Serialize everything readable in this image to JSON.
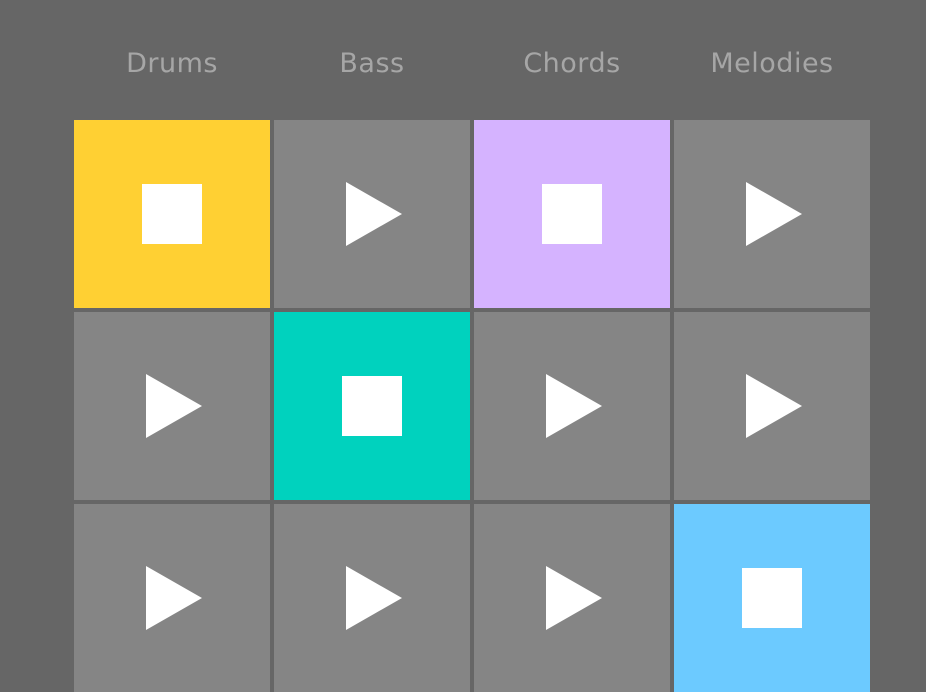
{
  "columns": [
    "Drums",
    "Bass",
    "Chords",
    "Melodies"
  ],
  "colors": {
    "background": "#666666",
    "pad_idle": "#858585",
    "drums_active": "#ffd033",
    "bass_active": "#00d2be",
    "chords_active": "#d5b3ff",
    "melodies_active": "#6ccaff",
    "icon": "#ffffff"
  },
  "pads": [
    [
      {
        "state": "playing",
        "icon": "stop-icon",
        "color": "#ffd033"
      },
      {
        "state": "idle",
        "icon": "play-icon",
        "color": "#858585"
      },
      {
        "state": "playing",
        "icon": "stop-icon",
        "color": "#d5b3ff"
      },
      {
        "state": "idle",
        "icon": "play-icon",
        "color": "#858585"
      }
    ],
    [
      {
        "state": "idle",
        "icon": "play-icon",
        "color": "#858585"
      },
      {
        "state": "playing",
        "icon": "stop-icon",
        "color": "#00d2be"
      },
      {
        "state": "idle",
        "icon": "play-icon",
        "color": "#858585"
      },
      {
        "state": "idle",
        "icon": "play-icon",
        "color": "#858585"
      }
    ],
    [
      {
        "state": "idle",
        "icon": "play-icon",
        "color": "#858585"
      },
      {
        "state": "idle",
        "icon": "play-icon",
        "color": "#858585"
      },
      {
        "state": "idle",
        "icon": "play-icon",
        "color": "#858585"
      },
      {
        "state": "playing",
        "icon": "stop-icon",
        "color": "#6ccaff"
      }
    ]
  ]
}
